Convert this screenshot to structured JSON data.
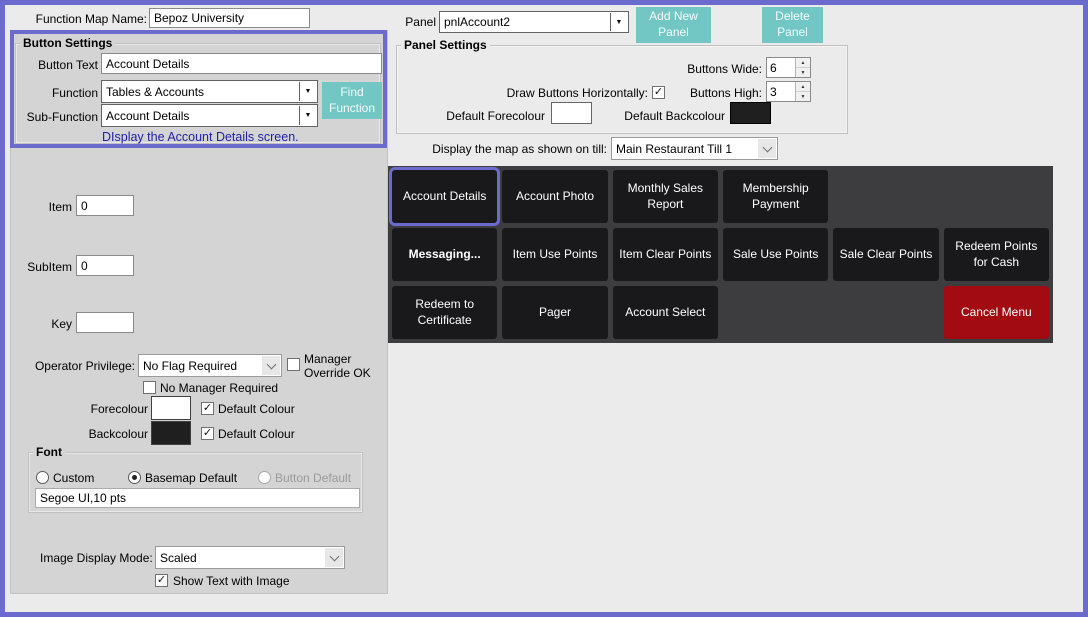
{
  "colors": {
    "accent": "#6b6bce",
    "teal": "#72c6c3",
    "grid_bg": "#3d3d40",
    "grid_button": "#19191b",
    "cancel_red": "#a30b12",
    "fore_swatch": "#ffffff",
    "back_swatch": "#1f1f1f",
    "desc_blue": "#2121a8",
    "panel_gray": "#d4d4d4",
    "window_bg": "#ebebeb"
  },
  "icons": {
    "dropdown_arrow": "▼",
    "spin_up": "▲",
    "spin_down": "▼",
    "checkmark": "✓"
  },
  "header": {
    "function_map_label": "Function Map Name:",
    "function_map_value": "Bepoz University",
    "panel_label": "Panel",
    "panel_value": "pnlAccount2",
    "add_panel_button": "Add New Panel",
    "delete_panel_button": "Delete Panel"
  },
  "button_settings": {
    "title": "Button Settings",
    "button_text_label": "Button Text",
    "button_text_value": "Account Details",
    "function_label": "Function",
    "function_value": "Tables & Accounts",
    "sub_function_label": "Sub-Function",
    "sub_function_value": "Account Details",
    "find_function_button": "Find Function",
    "description": "DIsplay the Account Details screen."
  },
  "button_detail": {
    "item_label": "Item",
    "item_value": "0",
    "subitem_label": "SubItem",
    "subitem_value": "0",
    "key_label": "Key",
    "key_value": "",
    "operator_privilege_label": "Operator Privilege:",
    "operator_privilege_value": "No Flag Required",
    "manager_override_label": "Manager Override OK",
    "no_manager_label": "No Manager Required",
    "forecolour_label": "Forecolour",
    "backcolour_label": "Backcolour",
    "default_colour_label": "Default Colour",
    "font": {
      "title": "Font",
      "options": [
        "Custom",
        "Basemap Default",
        "Button Default"
      ],
      "selected": "Basemap Default",
      "value": "Segoe UI,10 pts"
    },
    "image_display_mode_label": "Image Display Mode:",
    "image_display_mode_value": "Scaled",
    "show_text_label": "Show Text with Image"
  },
  "panel_settings": {
    "title": "Panel Settings",
    "buttons_wide_label": "Buttons Wide:",
    "buttons_wide_value": "6",
    "draw_horizontally_label": "Draw Buttons Horizontally:",
    "buttons_high_label": "Buttons High:",
    "buttons_high_value": "3",
    "default_forecolour_label": "Default Forecolour",
    "default_backcolour_label": "Default Backcolour"
  },
  "till": {
    "label": "Display the map as shown on till:",
    "value": "Main Restaurant Till 1"
  },
  "grid": {
    "rows": [
      [
        {
          "label": "Account Details",
          "style": "selected"
        },
        {
          "label": "Account Photo"
        },
        {
          "label": "Monthly Sales Report"
        },
        {
          "label": "Membership Payment"
        },
        {
          "label": ""
        },
        {
          "label": ""
        }
      ],
      [
        {
          "label": "Messaging...",
          "style": "bold"
        },
        {
          "label": "Item Use Points"
        },
        {
          "label": "Item Clear Points"
        },
        {
          "label": "Sale Use Points"
        },
        {
          "label": "Sale Clear Points"
        },
        {
          "label": "Redeem Points for Cash"
        }
      ],
      [
        {
          "label": "Redeem to Certificate"
        },
        {
          "label": "Pager"
        },
        {
          "label": "Account Select"
        },
        {
          "label": ""
        },
        {
          "label": ""
        },
        {
          "label": "Cancel Menu",
          "style": "red"
        }
      ]
    ]
  }
}
